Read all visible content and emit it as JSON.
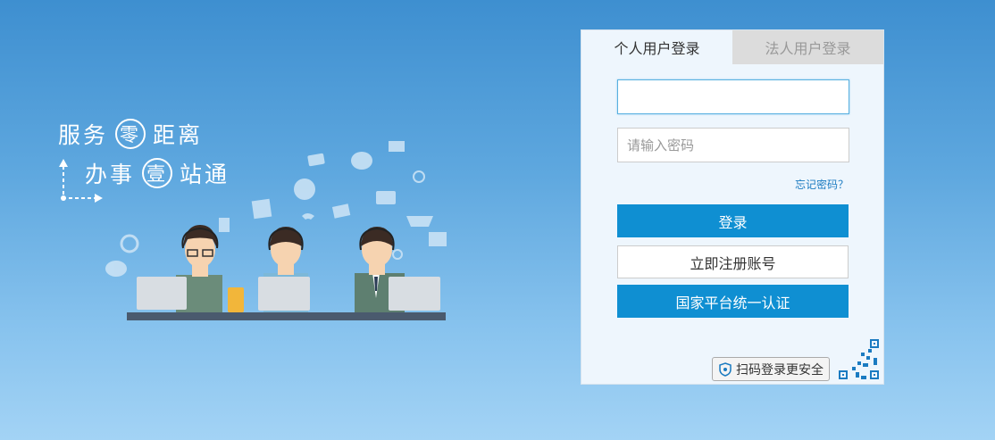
{
  "hero": {
    "slogan_line1_a": "服务",
    "slogan_line1_circle": "零",
    "slogan_line1_b": "距离",
    "slogan_line2_a": "办事",
    "slogan_line2_circle": "壹",
    "slogan_line2_b": "站通"
  },
  "login": {
    "tabs": [
      {
        "label": "个人用户登录",
        "active": true
      },
      {
        "label": "法人用户登录",
        "active": false
      }
    ],
    "username": {
      "value": "",
      "placeholder": ""
    },
    "password": {
      "value": "",
      "placeholder": "请输入密码"
    },
    "forgot_label": "忘记密码？",
    "login_label": "登录",
    "register_label": "立即注册账号",
    "national_auth_label": "国家平台统一认证",
    "qr_login_label": "扫码登录更安全"
  },
  "colors": {
    "primary": "#0f8fd2",
    "link": "#1b7bc1",
    "background_top": "#3e8fd0",
    "background_bottom": "#a3d3f5"
  }
}
